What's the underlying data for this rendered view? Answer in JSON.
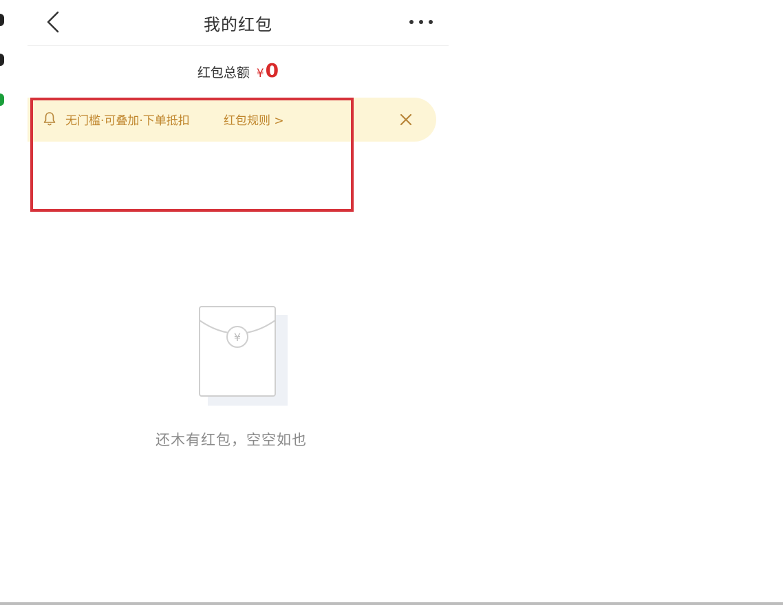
{
  "nav": {
    "title": "我的红包",
    "back_icon": "chevron-left-icon",
    "more_icon": "more-horizontal-icon"
  },
  "summary": {
    "label": "红包总额",
    "currency": "¥",
    "amount": "0"
  },
  "notice": {
    "icon": "bell-icon",
    "text": "无门槛·可叠加·下单抵扣",
    "link_label": "红包规则 >",
    "close_icon": "close-icon"
  },
  "empty_state": {
    "illustration": "red-packet-envelope-icon",
    "message": "还木有红包，空空如也"
  },
  "colors": {
    "accent": "#d92b2b",
    "notice_bg": "#fdf5d6",
    "notice_text": "#c0862e",
    "highlight_border": "#d6323a"
  }
}
